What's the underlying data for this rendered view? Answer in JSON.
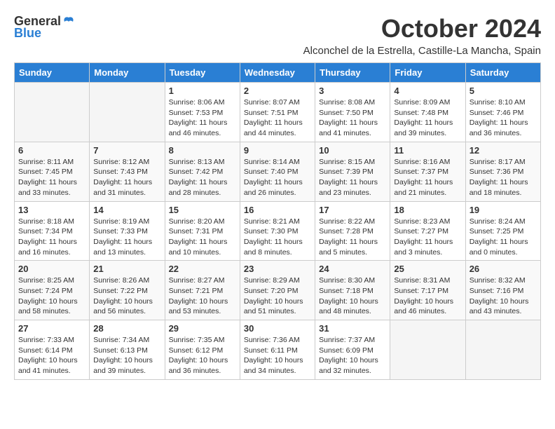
{
  "logo": {
    "general": "General",
    "blue": "Blue"
  },
  "title": "October 2024",
  "location": "Alconchel de la Estrella, Castille-La Mancha, Spain",
  "days_of_week": [
    "Sunday",
    "Monday",
    "Tuesday",
    "Wednesday",
    "Thursday",
    "Friday",
    "Saturday"
  ],
  "weeks": [
    [
      {
        "day": "",
        "empty": true
      },
      {
        "day": "",
        "empty": true
      },
      {
        "day": "1",
        "sunrise": "8:06 AM",
        "sunset": "7:53 PM",
        "daylight": "11 hours and 46 minutes."
      },
      {
        "day": "2",
        "sunrise": "8:07 AM",
        "sunset": "7:51 PM",
        "daylight": "11 hours and 44 minutes."
      },
      {
        "day": "3",
        "sunrise": "8:08 AM",
        "sunset": "7:50 PM",
        "daylight": "11 hours and 41 minutes."
      },
      {
        "day": "4",
        "sunrise": "8:09 AM",
        "sunset": "7:48 PM",
        "daylight": "11 hours and 39 minutes."
      },
      {
        "day": "5",
        "sunrise": "8:10 AM",
        "sunset": "7:46 PM",
        "daylight": "11 hours and 36 minutes."
      }
    ],
    [
      {
        "day": "6",
        "sunrise": "8:11 AM",
        "sunset": "7:45 PM",
        "daylight": "11 hours and 33 minutes."
      },
      {
        "day": "7",
        "sunrise": "8:12 AM",
        "sunset": "7:43 PM",
        "daylight": "11 hours and 31 minutes."
      },
      {
        "day": "8",
        "sunrise": "8:13 AM",
        "sunset": "7:42 PM",
        "daylight": "11 hours and 28 minutes."
      },
      {
        "day": "9",
        "sunrise": "8:14 AM",
        "sunset": "7:40 PM",
        "daylight": "11 hours and 26 minutes."
      },
      {
        "day": "10",
        "sunrise": "8:15 AM",
        "sunset": "7:39 PM",
        "daylight": "11 hours and 23 minutes."
      },
      {
        "day": "11",
        "sunrise": "8:16 AM",
        "sunset": "7:37 PM",
        "daylight": "11 hours and 21 minutes."
      },
      {
        "day": "12",
        "sunrise": "8:17 AM",
        "sunset": "7:36 PM",
        "daylight": "11 hours and 18 minutes."
      }
    ],
    [
      {
        "day": "13",
        "sunrise": "8:18 AM",
        "sunset": "7:34 PM",
        "daylight": "11 hours and 16 minutes."
      },
      {
        "day": "14",
        "sunrise": "8:19 AM",
        "sunset": "7:33 PM",
        "daylight": "11 hours and 13 minutes."
      },
      {
        "day": "15",
        "sunrise": "8:20 AM",
        "sunset": "7:31 PM",
        "daylight": "11 hours and 10 minutes."
      },
      {
        "day": "16",
        "sunrise": "8:21 AM",
        "sunset": "7:30 PM",
        "daylight": "11 hours and 8 minutes."
      },
      {
        "day": "17",
        "sunrise": "8:22 AM",
        "sunset": "7:28 PM",
        "daylight": "11 hours and 5 minutes."
      },
      {
        "day": "18",
        "sunrise": "8:23 AM",
        "sunset": "7:27 PM",
        "daylight": "11 hours and 3 minutes."
      },
      {
        "day": "19",
        "sunrise": "8:24 AM",
        "sunset": "7:25 PM",
        "daylight": "11 hours and 0 minutes."
      }
    ],
    [
      {
        "day": "20",
        "sunrise": "8:25 AM",
        "sunset": "7:24 PM",
        "daylight": "10 hours and 58 minutes."
      },
      {
        "day": "21",
        "sunrise": "8:26 AM",
        "sunset": "7:22 PM",
        "daylight": "10 hours and 56 minutes."
      },
      {
        "day": "22",
        "sunrise": "8:27 AM",
        "sunset": "7:21 PM",
        "daylight": "10 hours and 53 minutes."
      },
      {
        "day": "23",
        "sunrise": "8:29 AM",
        "sunset": "7:20 PM",
        "daylight": "10 hours and 51 minutes."
      },
      {
        "day": "24",
        "sunrise": "8:30 AM",
        "sunset": "7:18 PM",
        "daylight": "10 hours and 48 minutes."
      },
      {
        "day": "25",
        "sunrise": "8:31 AM",
        "sunset": "7:17 PM",
        "daylight": "10 hours and 46 minutes."
      },
      {
        "day": "26",
        "sunrise": "8:32 AM",
        "sunset": "7:16 PM",
        "daylight": "10 hours and 43 minutes."
      }
    ],
    [
      {
        "day": "27",
        "sunrise": "7:33 AM",
        "sunset": "6:14 PM",
        "daylight": "10 hours and 41 minutes."
      },
      {
        "day": "28",
        "sunrise": "7:34 AM",
        "sunset": "6:13 PM",
        "daylight": "10 hours and 39 minutes."
      },
      {
        "day": "29",
        "sunrise": "7:35 AM",
        "sunset": "6:12 PM",
        "daylight": "10 hours and 36 minutes."
      },
      {
        "day": "30",
        "sunrise": "7:36 AM",
        "sunset": "6:11 PM",
        "daylight": "10 hours and 34 minutes."
      },
      {
        "day": "31",
        "sunrise": "7:37 AM",
        "sunset": "6:09 PM",
        "daylight": "10 hours and 32 minutes."
      },
      {
        "day": "",
        "empty": true
      },
      {
        "day": "",
        "empty": true
      }
    ]
  ]
}
